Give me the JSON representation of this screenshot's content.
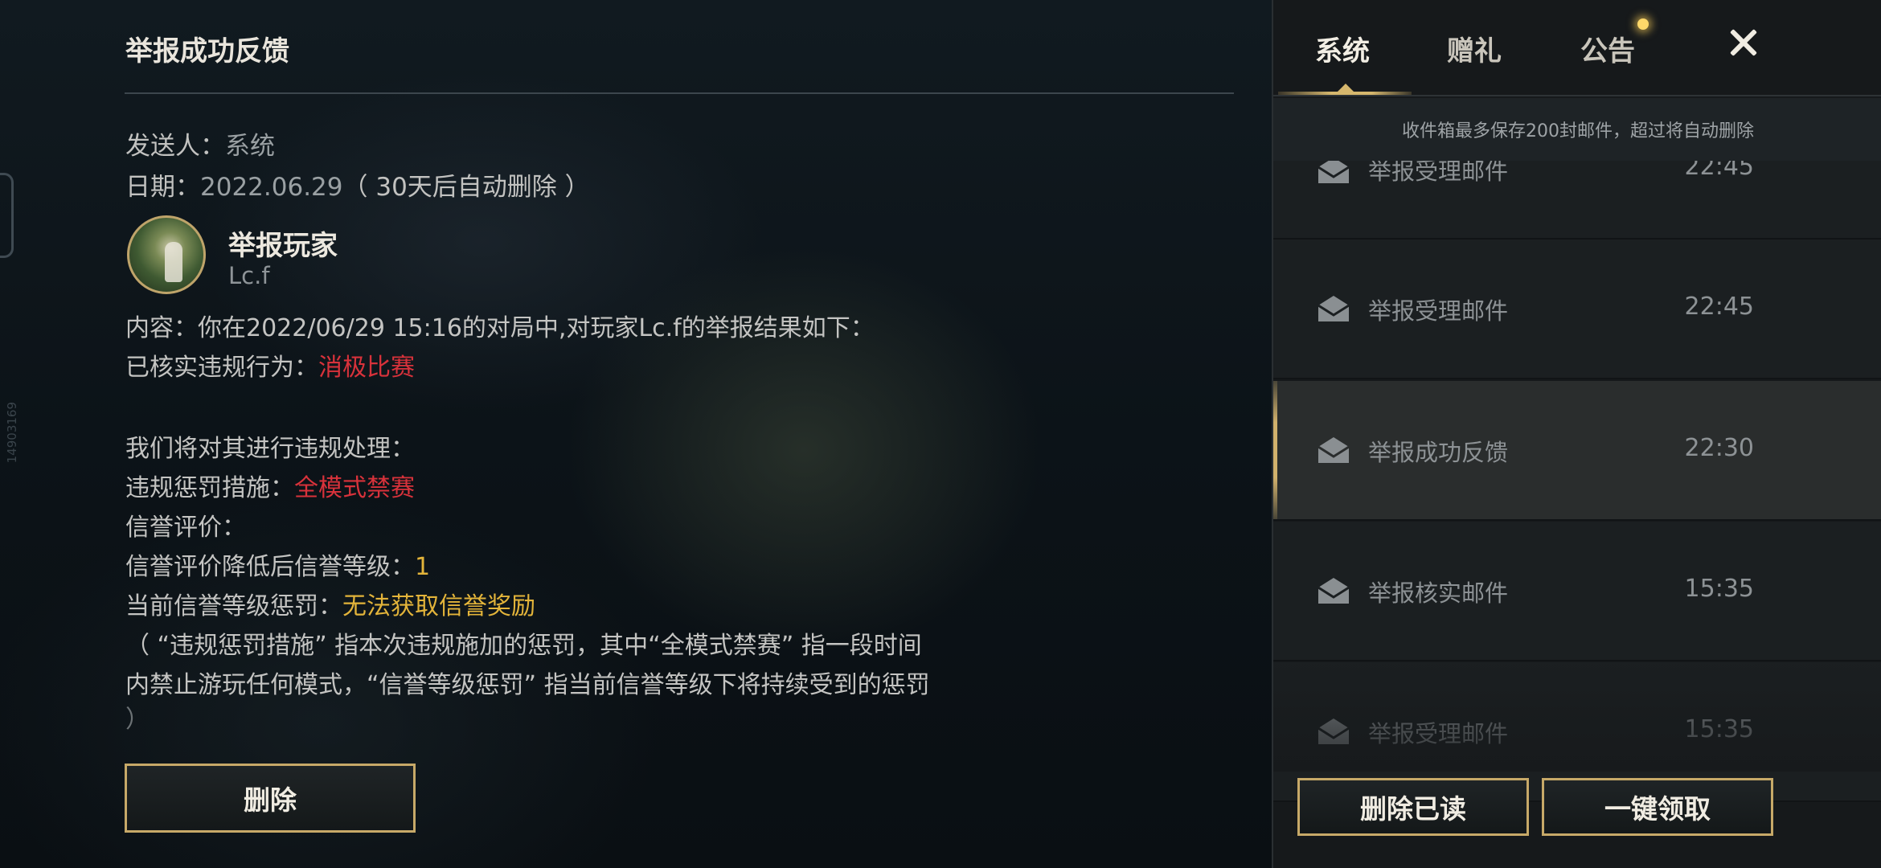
{
  "mail_detail": {
    "title": "举报成功反馈",
    "sender_label": "发送人：",
    "sender_value": "系统",
    "date_label": "日期：",
    "date_value": "2022.06.29",
    "date_note": "（ 30天后自动删除 ）",
    "player": {
      "name": "举报玩家",
      "id": "Lc.f"
    },
    "content_line": "内容：你在2022/06/29 15:16的对局中,对玩家Lc.f的举报结果如下：",
    "violation_label": "已核实违规行为：",
    "violation_value": "消极比赛",
    "handling_line": "我们将对其进行违规处理：",
    "penalty_label": "违规惩罚措施：",
    "penalty_value": "全模式禁赛",
    "reputation_label": "信誉评价：",
    "reputation_level_label": "信誉评价降低后信誉等级：",
    "reputation_level_value": "1",
    "reputation_penalty_label": "当前信誉等级惩罚：",
    "reputation_penalty_value": "无法获取信誉奖励",
    "note_line1": "（ “违规惩罚措施” 指本次违规施加的惩罚，其中“全模式禁赛” 指一段时间",
    "note_line2": "内禁止游玩任何模式，“信誉等级惩罚” 指当前信誉等级下将持续受到的惩罚",
    "note_line3": "）",
    "delete_label": "删除"
  },
  "side_id": "14903169",
  "inbox": {
    "tabs": [
      {
        "label": "系统",
        "active": true
      },
      {
        "label": "赠礼",
        "active": false
      },
      {
        "label": "公告",
        "active": false,
        "has_notification": true
      }
    ],
    "notice": "收件箱最多保存200封邮件，超过将自动删除",
    "items": [
      {
        "subject": "举报受理邮件",
        "time": "22:45",
        "icon": "mail-icon"
      },
      {
        "subject": "举报受理邮件",
        "time": "22:45",
        "icon": "mail-icon"
      },
      {
        "subject": "举报成功反馈",
        "time": "22:30",
        "icon": "mail-icon",
        "selected": true
      },
      {
        "subject": "举报核实邮件",
        "time": "15:35",
        "icon": "mail-icon"
      },
      {
        "subject": "举报受理邮件",
        "time": "15:35",
        "icon": "mail-icon"
      }
    ],
    "delete_read_label": "删除已读",
    "claim_all_label": "一键领取"
  },
  "colors": {
    "gold_border": "#c7a968",
    "red_text": "#d8323b",
    "yellow_text": "#e3b43a",
    "notify_dot": "#ffd86a"
  }
}
